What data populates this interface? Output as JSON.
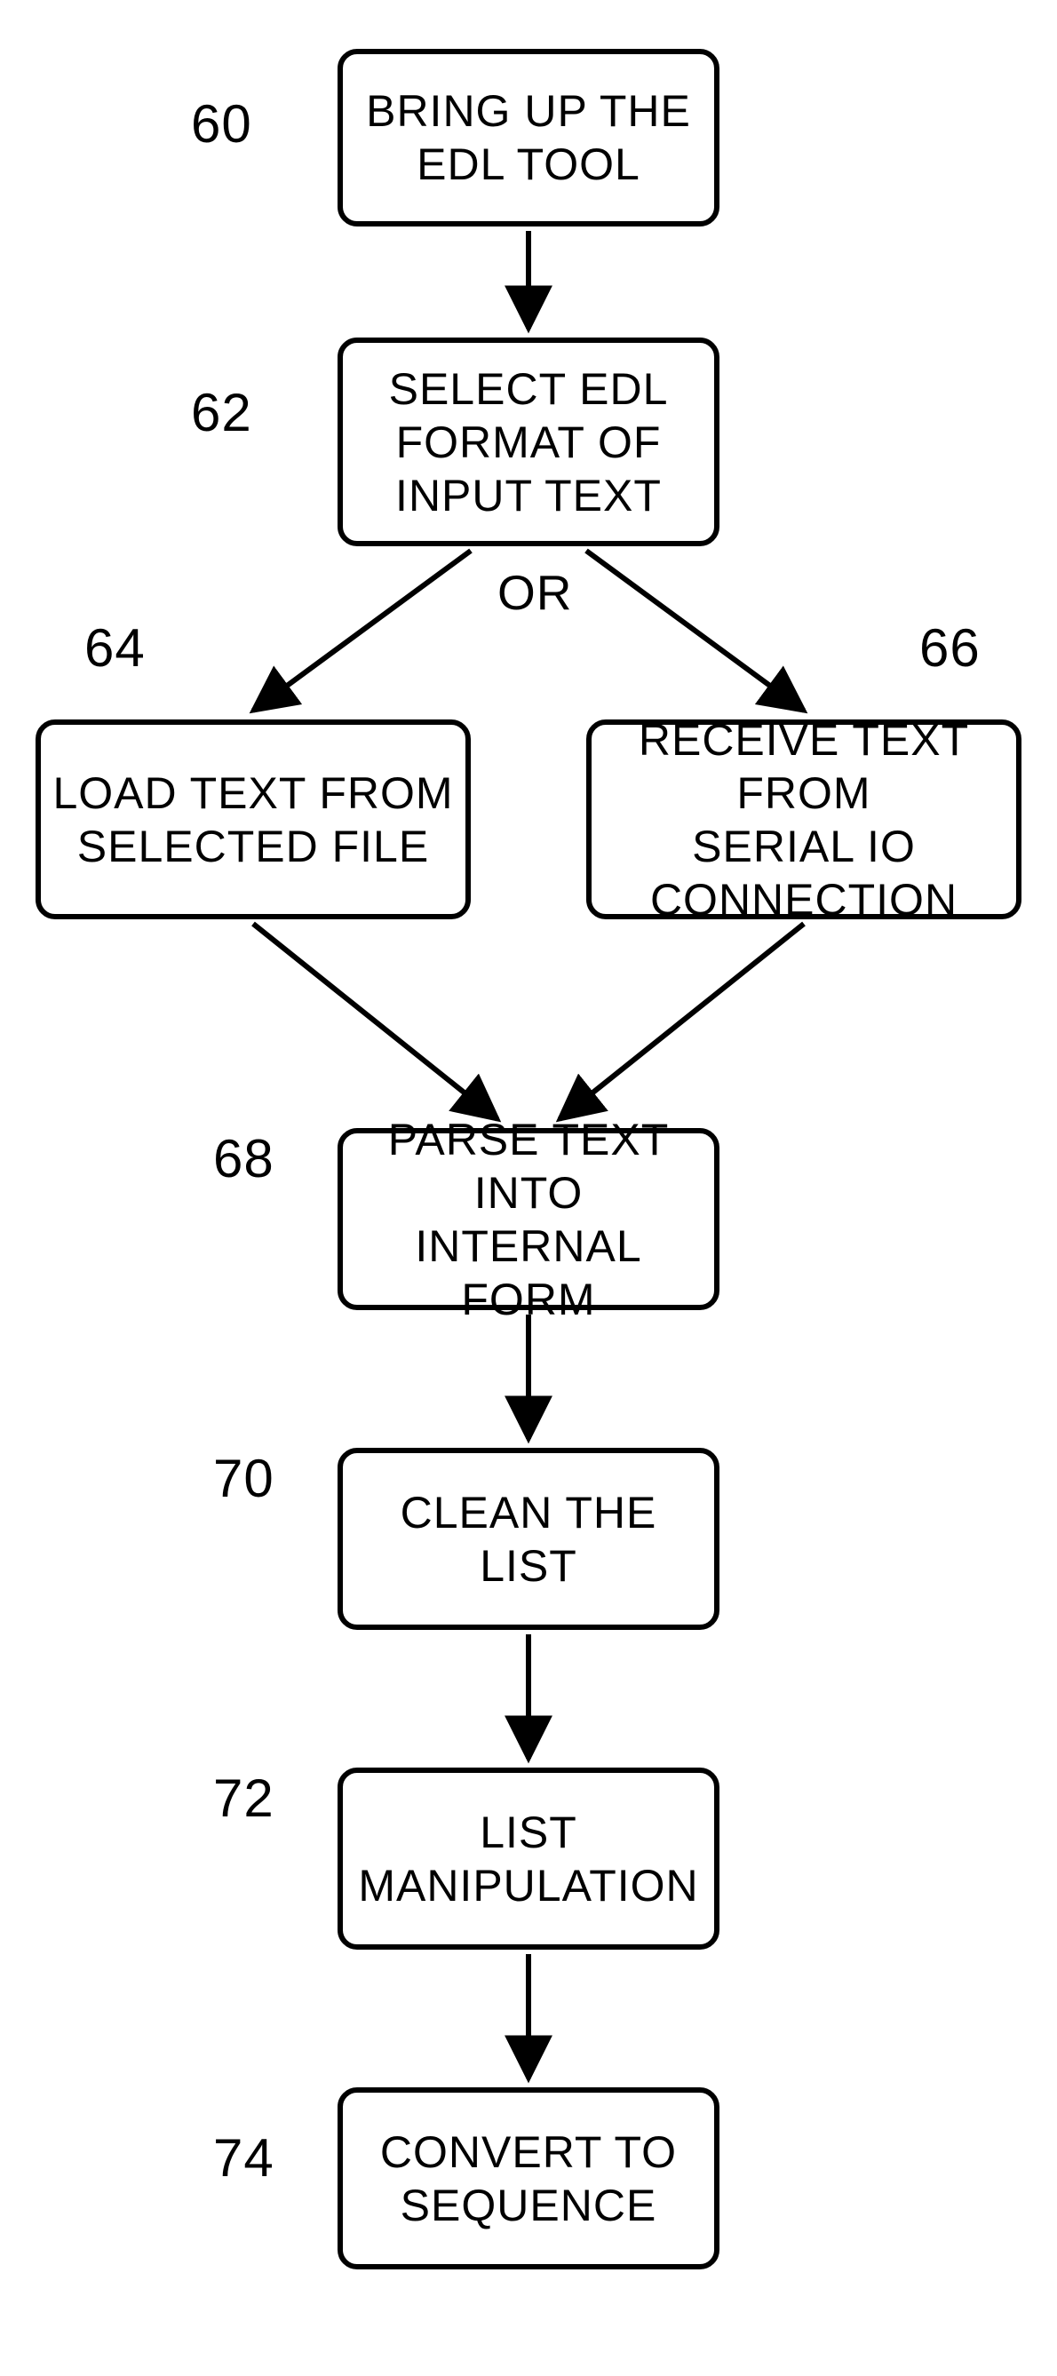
{
  "chart_data": {
    "type": "flowchart",
    "nodes": [
      {
        "id": "60",
        "ref": "60",
        "text": "BRING UP THE EDL TOOL"
      },
      {
        "id": "62",
        "ref": "62",
        "text": "SELECT EDL FORMAT OF INPUT TEXT"
      },
      {
        "id": "64",
        "ref": "64",
        "text": "LOAD TEXT FROM SELECTED FILE"
      },
      {
        "id": "66",
        "ref": "66",
        "text": "RECEIVE TEXT FROM SERIAL IO CONNECTION"
      },
      {
        "id": "68",
        "ref": "68",
        "text": "PARSE TEXT INTO INTERNAL FORM"
      },
      {
        "id": "70",
        "ref": "70",
        "text": "CLEAN THE LIST"
      },
      {
        "id": "72",
        "ref": "72",
        "text": "LIST MANIPULATION"
      },
      {
        "id": "74",
        "ref": "74",
        "text": "CONVERT TO SEQUENCE"
      }
    ],
    "edges": [
      {
        "from": "60",
        "to": "62"
      },
      {
        "from": "62",
        "to": "64",
        "label": "OR"
      },
      {
        "from": "62",
        "to": "66",
        "label": "OR"
      },
      {
        "from": "64",
        "to": "68"
      },
      {
        "from": "66",
        "to": "68"
      },
      {
        "from": "68",
        "to": "70"
      },
      {
        "from": "70",
        "to": "72"
      },
      {
        "from": "72",
        "to": "74"
      }
    ],
    "branch_label": "OR"
  },
  "nodes": {
    "n60": {
      "ref": "60",
      "text": "BRING UP THE\nEDL TOOL"
    },
    "n62": {
      "ref": "62",
      "text": "SELECT EDL\nFORMAT OF\nINPUT TEXT"
    },
    "n64": {
      "ref": "64",
      "text": "LOAD TEXT FROM\nSELECTED FILE"
    },
    "n66": {
      "ref": "66",
      "text": "RECEIVE TEXT FROM\nSERIAL  IO\nCONNECTION"
    },
    "n68": {
      "ref": "68",
      "text": "PARSE TEXT INTO\nINTERNAL FORM"
    },
    "n70": {
      "ref": "70",
      "text": "CLEAN THE\nLIST"
    },
    "n72": {
      "ref": "72",
      "text": "LIST\nMANIPULATION"
    },
    "n74": {
      "ref": "74",
      "text": "CONVERT TO\nSEQUENCE"
    }
  },
  "labels": {
    "or": "OR"
  }
}
